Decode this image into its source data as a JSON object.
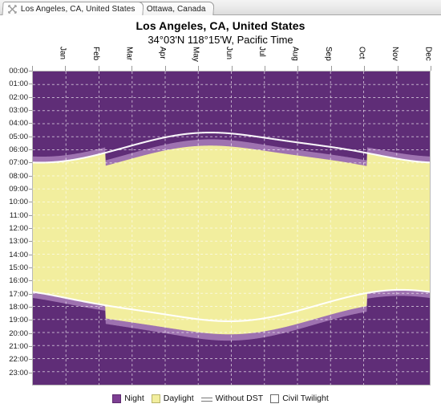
{
  "window": {
    "tabs": [
      {
        "label": "Los Angeles, CA, United States",
        "icon": "close-icon",
        "active": true
      },
      {
        "label": "Ottawa, Canada",
        "icon": "close-icon",
        "active": false
      }
    ]
  },
  "header": {
    "title": "Los Angeles, CA, United States",
    "subtitle": "34°03'N 118°15'W, Pacific Time"
  },
  "legend": [
    {
      "key": "night",
      "label": "Night",
      "swatch": "solid",
      "color": "#7d3f93"
    },
    {
      "key": "daylight",
      "label": "Daylight",
      "swatch": "solid",
      "color": "#f2ee9e"
    },
    {
      "key": "without_dst",
      "label": "Without DST",
      "swatch": "line",
      "color": "#ffffff"
    },
    {
      "key": "civil_twilight",
      "label": "Civil Twilight",
      "swatch": "solid",
      "color": "#ffffff"
    }
  ],
  "colors": {
    "night": "#5f2d77",
    "night_legend": "#7d3f93",
    "civil_twilight": "#9e72b0",
    "daylight": "#f2ee9e",
    "without_dst_line": "#ffffff",
    "grid": "#ffffff",
    "axis": "#b9b9b9",
    "tab_bar": "#e8e8e8",
    "page_background": "#ffffff"
  },
  "chart_data": {
    "type": "area",
    "title": "Los Angeles, CA, United States",
    "subtitle": "34°03'N 118°15'W, Pacific Time",
    "xlabel": "",
    "ylabel": "",
    "grid": true,
    "legend_position": "bottom",
    "x_categories": [
      "Jan",
      "Feb",
      "Mar",
      "Apr",
      "May",
      "Jun",
      "Jul",
      "Aug",
      "Sep",
      "Oct",
      "Nov",
      "Dec"
    ],
    "x_tick_labels": [
      "Jan",
      "Feb",
      "Mar",
      "Apr",
      "May",
      "Jun",
      "Jul",
      "Aug",
      "Sep",
      "Oct",
      "Nov",
      "Dec"
    ],
    "y_tick_labels": [
      "00:00",
      "01:00",
      "02:00",
      "03:00",
      "04:00",
      "05:00",
      "06:00",
      "07:00",
      "08:00",
      "09:00",
      "10:00",
      "11:00",
      "12:00",
      "13:00",
      "14:00",
      "15:00",
      "16:00",
      "17:00",
      "18:00",
      "19:00",
      "20:00",
      "21:00",
      "22:00",
      "23:00"
    ],
    "ylim": [
      "00:00",
      "24:00"
    ],
    "dst_start_month": "Mar",
    "dst_end_month": "Nov",
    "series": [
      {
        "name": "Sunrise (local clock time, with DST)",
        "x": [
          "Jan",
          "Feb",
          "Mar",
          "Mar",
          "Apr",
          "May",
          "Jun",
          "Jul",
          "Aug",
          "Sep",
          "Oct",
          "Nov",
          "Nov",
          "Dec"
        ],
        "values": [
          "06:58",
          "06:44",
          "06:14",
          "07:10",
          "06:30",
          "06:00",
          "05:42",
          "05:50",
          "06:12",
          "06:33",
          "06:55",
          "07:19",
          "06:22",
          "06:45"
        ]
      },
      {
        "name": "Sunset (local clock time, with DST)",
        "x": [
          "Jan",
          "Feb",
          "Mar",
          "Mar",
          "Apr",
          "May",
          "Jun",
          "Jul",
          "Aug",
          "Sep",
          "Oct",
          "Nov",
          "Nov",
          "Dec"
        ],
        "values": [
          "17:02",
          "17:30",
          "17:56",
          "19:02",
          "19:24",
          "19:46",
          "20:06",
          "20:05",
          "19:38",
          "18:58",
          "18:20",
          "17:50",
          "16:52",
          "16:44"
        ]
      },
      {
        "name": "Sunrise (without DST)",
        "x": [
          "Jan",
          "Feb",
          "Mar",
          "Apr",
          "May",
          "Jun",
          "Jul",
          "Aug",
          "Sep",
          "Oct",
          "Nov",
          "Dec"
        ],
        "values": [
          "06:58",
          "06:44",
          "06:14",
          "05:30",
          "05:00",
          "04:42",
          "04:50",
          "05:12",
          "05:33",
          "05:55",
          "06:19",
          "06:45"
        ]
      },
      {
        "name": "Sunset (without DST)",
        "x": [
          "Jan",
          "Feb",
          "Mar",
          "Apr",
          "May",
          "Jun",
          "Jul",
          "Aug",
          "Sep",
          "Oct",
          "Nov",
          "Dec"
        ],
        "values": [
          "17:02",
          "17:30",
          "17:56",
          "18:24",
          "18:46",
          "19:06",
          "19:05",
          "18:38",
          "17:58",
          "17:20",
          "16:50",
          "16:44"
        ]
      },
      {
        "name": "Civil twilight band width (minutes)",
        "values": [
          26,
          25,
          24,
          24,
          25,
          27,
          27,
          25,
          24,
          24,
          25,
          26
        ]
      }
    ]
  }
}
